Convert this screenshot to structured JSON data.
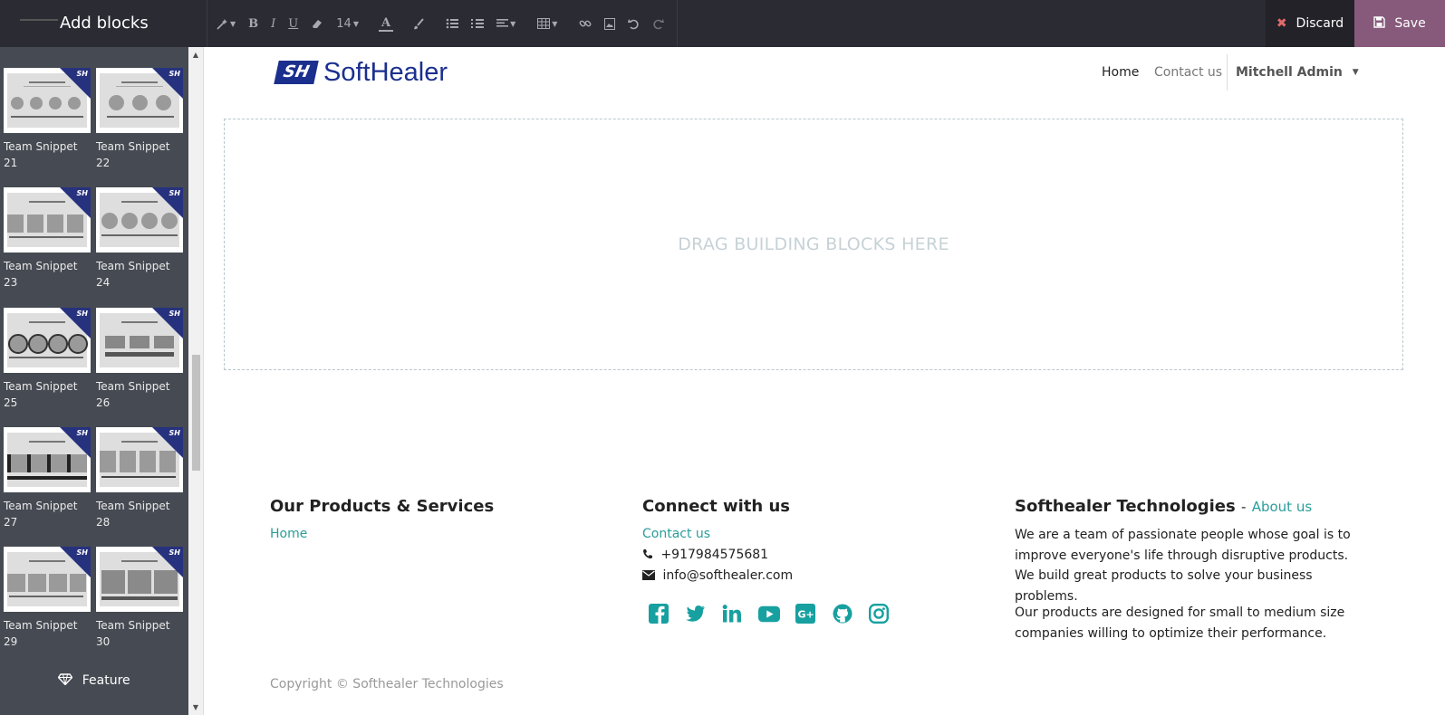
{
  "toolbar": {
    "title": "Add blocks",
    "font_size": "14",
    "discard_label": "Discard",
    "save_label": "Save",
    "save_color": "#875a7b"
  },
  "sidebar": {
    "snippets": [
      {
        "line1": "Team Snippet",
        "line2": "21"
      },
      {
        "line1": "Team Snippet",
        "line2": "22"
      },
      {
        "line1": "Team Snippet",
        "line2": "23"
      },
      {
        "line1": "Team Snippet",
        "line2": "24"
      },
      {
        "line1": "Team Snippet",
        "line2": "25"
      },
      {
        "line1": "Team Snippet",
        "line2": "26"
      },
      {
        "line1": "Team Snippet",
        "line2": "27"
      },
      {
        "line1": "Team Snippet",
        "line2": "28"
      },
      {
        "line1": "Team Snippet",
        "line2": "29"
      },
      {
        "line1": "Team Snippet",
        "line2": "30"
      }
    ],
    "feature_label": "Feature"
  },
  "header": {
    "logo_mark": "SH",
    "logo_text": "SoftHealer",
    "nav_home": "Home",
    "nav_contact": "Contact us",
    "nav_user": "Mitchell Admin"
  },
  "dropzone": {
    "text": "DRAG BUILDING BLOCKS HERE"
  },
  "footer": {
    "col1_title": "Our Products & Services",
    "col1_link": "Home",
    "col2_title": "Connect with us",
    "col2_link": "Contact us",
    "phone": "+917984575681",
    "email": "info@softhealer.com",
    "col3_title": "Softhealer Technologies",
    "col3_sep": "-",
    "col3_link": "About us",
    "about_p1": "We are a team of passionate people whose goal is to improve everyone's life through disruptive products. We build great products to solve your business problems.",
    "about_p2": "Our products are designed for small to medium size companies willing to optimize their performance.",
    "copyright": "Copyright © Softhealer Technologies",
    "social_color": "#17a0a0"
  }
}
